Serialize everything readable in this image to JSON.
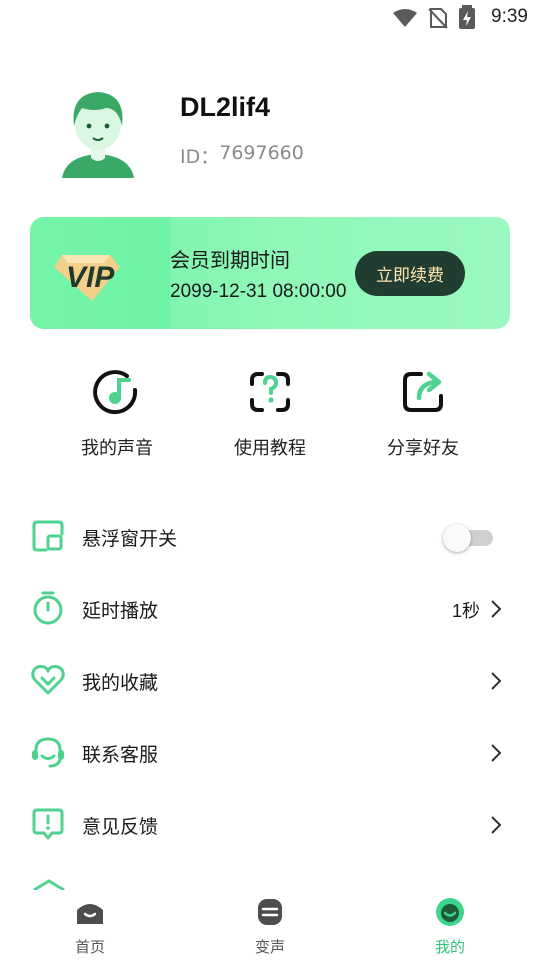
{
  "status_bar": {
    "time": "9:39"
  },
  "profile": {
    "username": "DL2lif4",
    "id_label": "ID：",
    "id_value": "7697660"
  },
  "vip": {
    "badge_text": "VIP",
    "title": "会员到期时间",
    "expiry": "2099-12-31 08:00:00",
    "renew_label": "立即续费"
  },
  "quick_actions": [
    {
      "label": "我的声音",
      "icon": "music-note-icon"
    },
    {
      "label": "使用教程",
      "icon": "question-mark-icon"
    },
    {
      "label": "分享好友",
      "icon": "share-arrow-icon"
    }
  ],
  "menu": [
    {
      "label": "悬浮窗开关",
      "icon": "floating-window-icon",
      "control": "toggle",
      "toggle_on": false
    },
    {
      "label": "延时播放",
      "icon": "stopwatch-icon",
      "value": "1秒"
    },
    {
      "label": "我的收藏",
      "icon": "heart-icon"
    },
    {
      "label": "联系客服",
      "icon": "headset-icon"
    },
    {
      "label": "意见反馈",
      "icon": "feedback-icon"
    }
  ],
  "bottom_nav": [
    {
      "label": "首页",
      "icon": "home-icon",
      "active": false
    },
    {
      "label": "变声",
      "icon": "voice-change-icon",
      "active": false
    },
    {
      "label": "我的",
      "icon": "profile-face-icon",
      "active": true
    }
  ],
  "colors": {
    "accent_green": "#3dd68c",
    "icon_green": "#4fd28f",
    "renew_button_bg": "#213c30",
    "renew_button_text": "#ffe6b0",
    "nav_inactive": "#555555"
  }
}
